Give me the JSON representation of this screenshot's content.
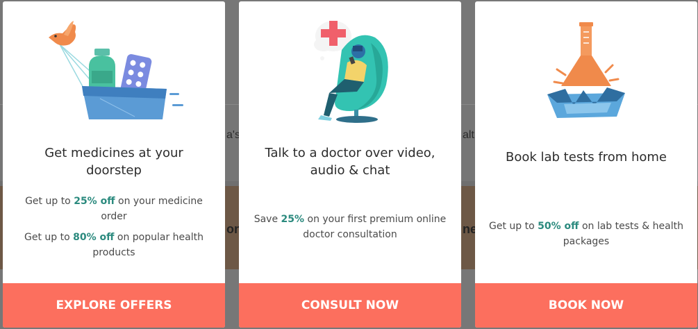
{
  "background": {
    "fragment_left": "a's",
    "fragment_right": "alt",
    "fragment_bold_left": "on",
    "fragment_bold_right": "ne"
  },
  "cards": [
    {
      "title": "Get medicines at your doorstep",
      "offers": [
        {
          "pre": "Get up to ",
          "highlight": "25% off",
          "post": " on your medicine order"
        },
        {
          "pre": "Get up to ",
          "highlight": "80% off",
          "post": " on popular health products"
        }
      ],
      "cta": "EXPLORE OFFERS",
      "illustration": "medicine-basket-bird-icon"
    },
    {
      "title": "Talk to a doctor over video, audio & chat",
      "offers": [
        {
          "pre": "Save ",
          "highlight": "25%",
          "post": " on your first premium online doctor consultation"
        }
      ],
      "cta": "CONSULT NOW",
      "illustration": "patient-chair-phone-icon"
    },
    {
      "title": "Book lab tests from home",
      "offers": [
        {
          "pre": "Get up to ",
          "highlight": "50% off",
          "post": " on lab tests & health packages"
        }
      ],
      "cta": "BOOK NOW",
      "illustration": "lab-flask-icon"
    }
  ],
  "colors": {
    "cta": "#fc6f5e",
    "highlight": "#2b8a7e",
    "overlay": "#6f6f6f"
  }
}
